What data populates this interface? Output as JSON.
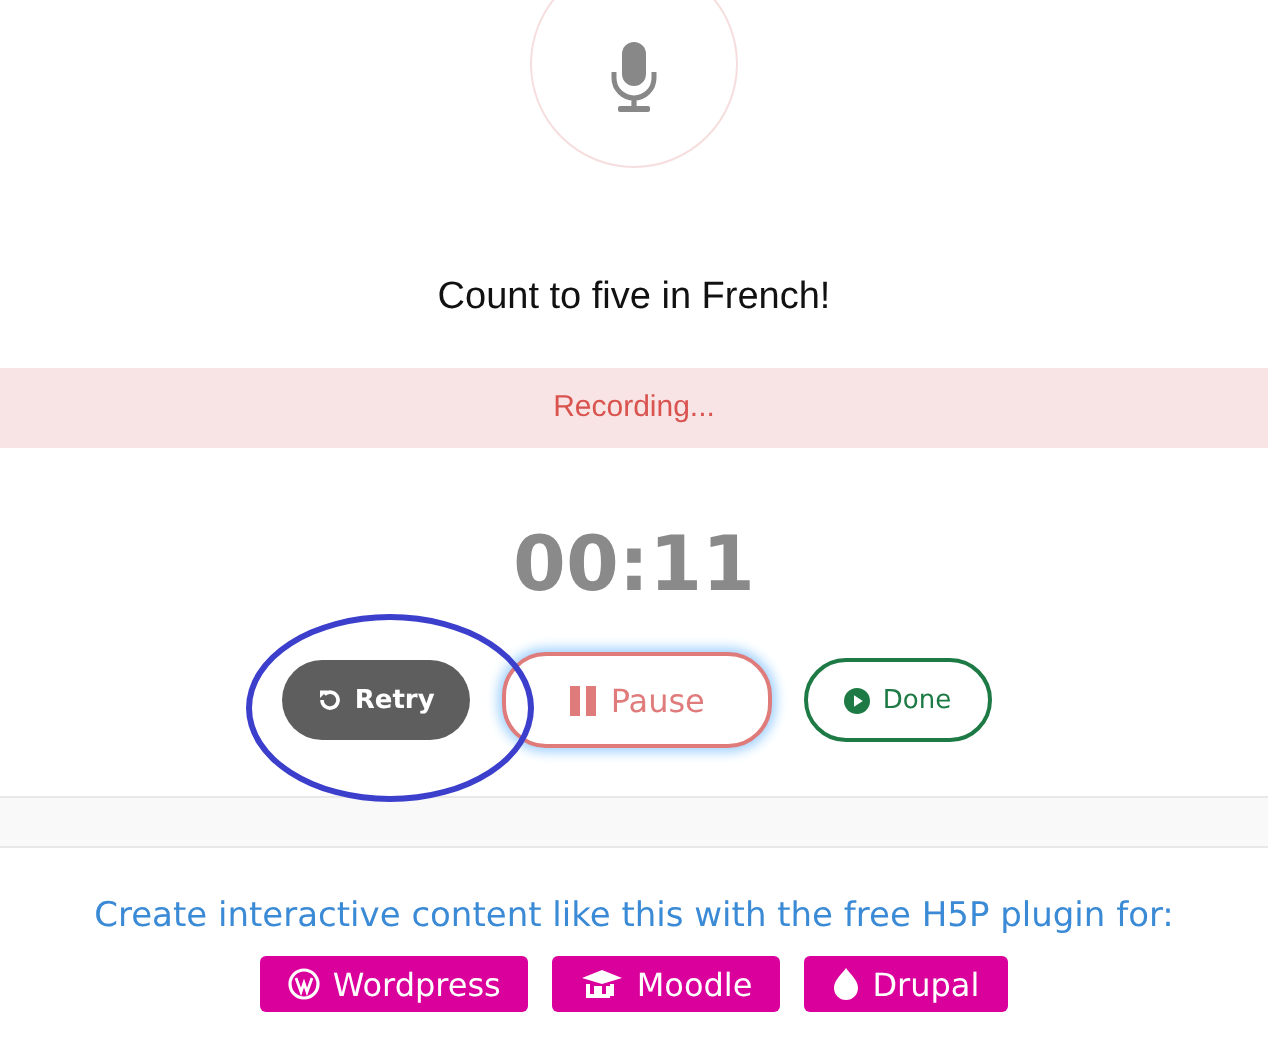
{
  "prompt": "Count to five in French!",
  "status": "Recording...",
  "timer": "00:11",
  "controls": [
    {
      "kind": "retry",
      "label": "Retry",
      "focused": false
    },
    {
      "kind": "pause",
      "label": "Pause",
      "focused": true
    },
    {
      "kind": "done",
      "label": "Done",
      "focused": false
    }
  ],
  "promo": {
    "text": "Create interactive content like this with the free H5P plugin for:",
    "platforms": [
      {
        "kind": "wordpress",
        "label": "Wordpress"
      },
      {
        "kind": "moodle",
        "label": "Moodle"
      },
      {
        "kind": "drupal",
        "label": "Drupal"
      }
    ]
  }
}
